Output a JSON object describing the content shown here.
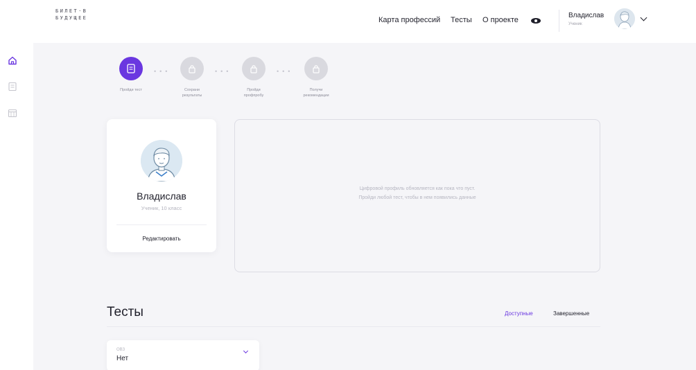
{
  "brand": {
    "logo_line1": "БИЛЕТ·В",
    "logo_line2": "БУДУЩЕЕ"
  },
  "nav": {
    "items": [
      {
        "label": "Карта профессий"
      },
      {
        "label": "Тесты"
      },
      {
        "label": "О проекте"
      }
    ],
    "accessibility_icon": "eye-icon"
  },
  "user": {
    "name": "Владислав",
    "role": "Ученик"
  },
  "sidebar": {
    "icons": [
      "home-icon",
      "document-icon",
      "calendar-icon"
    ]
  },
  "steps": [
    {
      "line1": "Пройди тест",
      "line2": "",
      "active": true,
      "icon": "document-icon"
    },
    {
      "line1": "Сохрани",
      "line2": "результаты",
      "active": false,
      "icon": "lock-icon"
    },
    {
      "line1": "Пройди",
      "line2": "профпробу",
      "active": false,
      "icon": "lock-icon"
    },
    {
      "line1": "Получи",
      "line2": "рекомендации",
      "active": false,
      "icon": "lock-icon"
    }
  ],
  "profile": {
    "name": "Владислав",
    "grade": "Ученик, 10 класс",
    "edit_label": "Редактировать"
  },
  "digital_profile": {
    "line1": "Цифровой профиль обновляется как пока что пуст.",
    "line2": "Пройди любой тест, чтобы в нем появились данные"
  },
  "tests": {
    "title": "Тесты",
    "tabs": [
      {
        "label": "Доступные",
        "active": true
      },
      {
        "label": "Завершенные",
        "active": false
      }
    ],
    "filter": {
      "label": "ОВЗ",
      "value": "Нет"
    }
  },
  "colors": {
    "accent": "#6a37e0",
    "inactive_step": "#d9d9df",
    "background": "#f5f5f8"
  }
}
